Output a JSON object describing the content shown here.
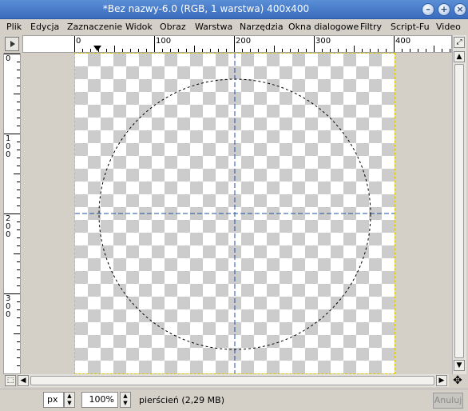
{
  "window": {
    "title": "*Bez nazwy-6.0 (RGB, 1 warstwa) 400x400"
  },
  "window_buttons": [
    "–",
    "+",
    "×"
  ],
  "menu": [
    "Plik",
    "Edycja",
    "Zaznaczenie",
    "Widok",
    "Obraz",
    "Warstwa",
    "Narzędzia",
    "Okna dialogowe",
    "Filtry",
    "Script-Fu",
    "Video"
  ],
  "ruler": {
    "h_labels": [
      "0",
      "100",
      "200",
      "300",
      "400"
    ],
    "v_labels": [
      "0",
      "100",
      "200",
      "300"
    ]
  },
  "image": {
    "width": 400,
    "height": 400,
    "selection": "ellipse",
    "guides": {
      "horizontal": 200,
      "vertical": 200
    }
  },
  "status": {
    "unit": "px",
    "zoom": "100%",
    "info": "pierścień (2,29 MB)",
    "cancel_label": "Anuluj"
  },
  "colors": {
    "titlebar": "#3a6bbd",
    "guide": "#1e4fa0",
    "canvas_border": "#d8c800"
  }
}
